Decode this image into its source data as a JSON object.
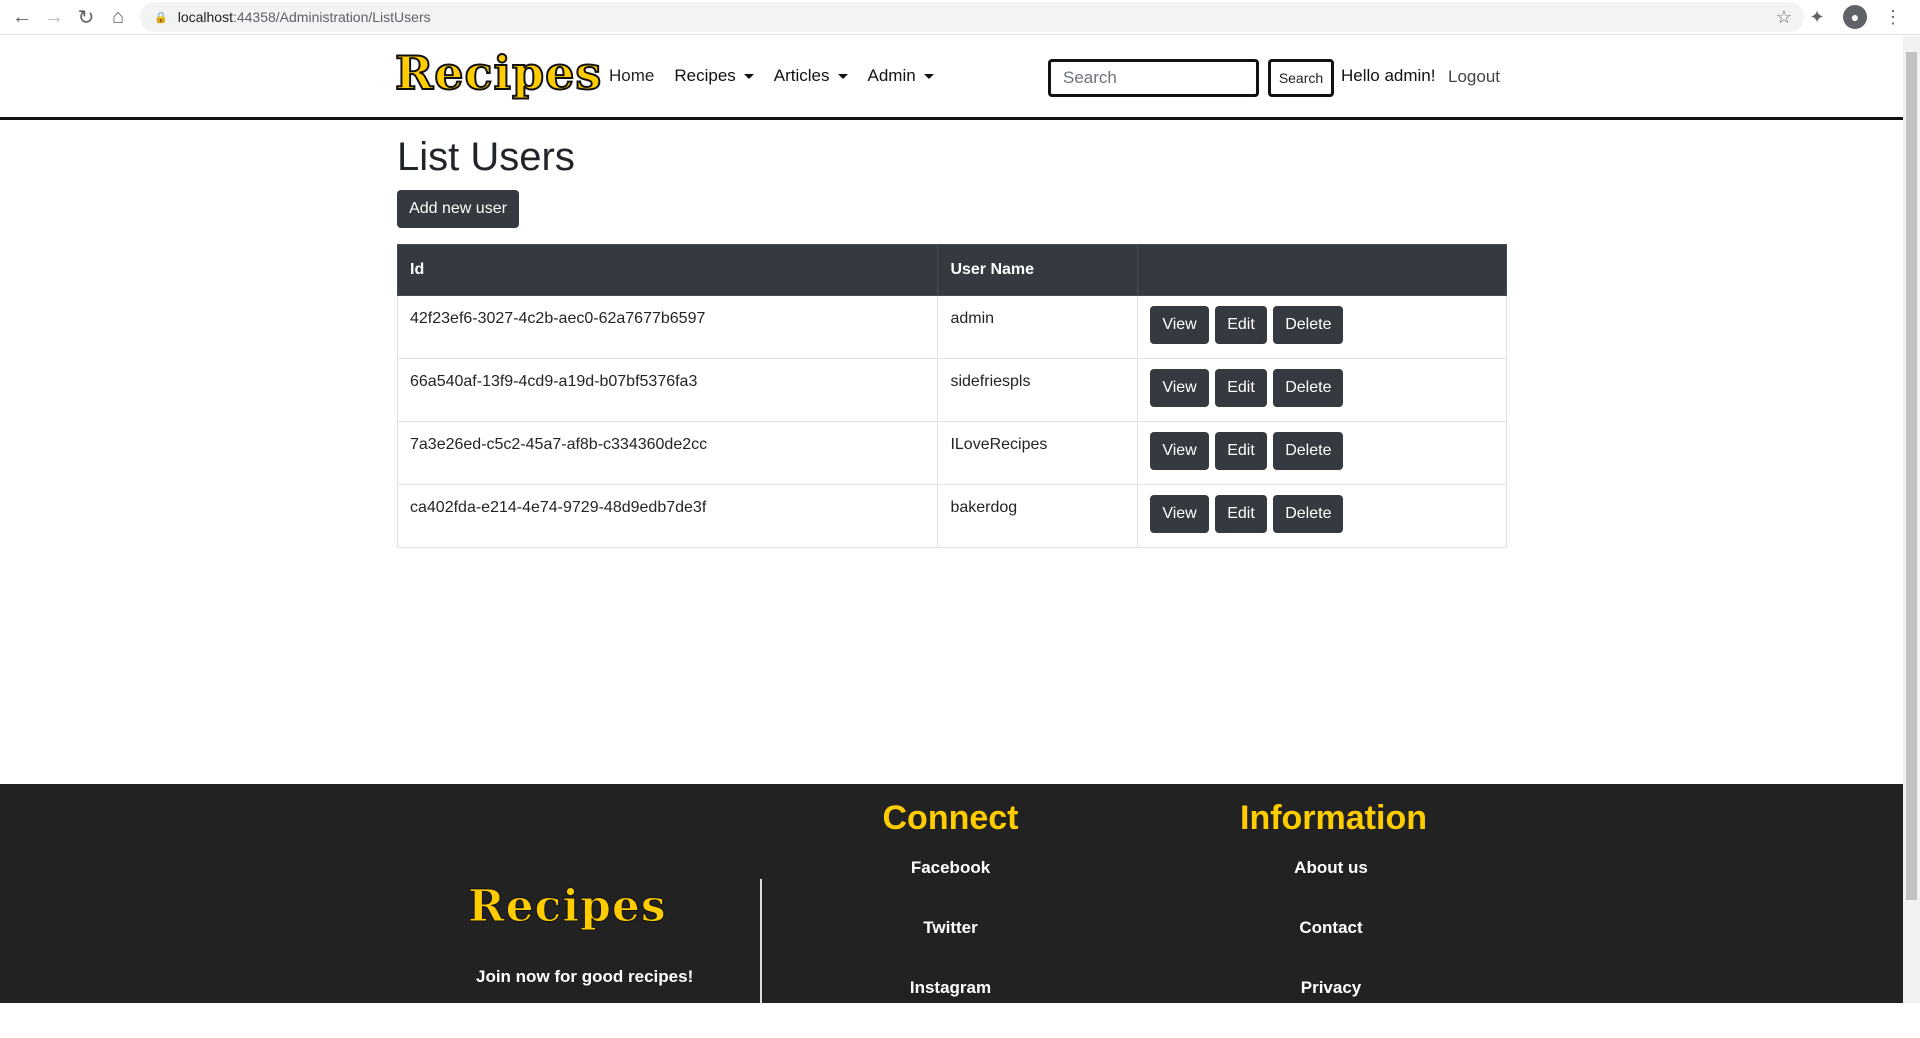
{
  "browser": {
    "url_host": "localhost",
    "url_rest": ":44358/Administration/ListUsers"
  },
  "header": {
    "logo": "Recipes",
    "nav": [
      {
        "label": "Home",
        "dropdown": false
      },
      {
        "label": "Recipes",
        "dropdown": true
      },
      {
        "label": "Articles",
        "dropdown": true
      },
      {
        "label": "Admin",
        "dropdown": true
      }
    ],
    "search_placeholder": "Search",
    "search_button": "Search",
    "greeting": "Hello admin!",
    "logout": "Logout"
  },
  "main": {
    "title": "List Users",
    "add_button": "Add new user",
    "table": {
      "headers": [
        "Id",
        "User Name",
        ""
      ],
      "rows": [
        {
          "id": "42f23ef6-3027-4c2b-aec0-62a7677b6597",
          "username": "admin"
        },
        {
          "id": "66a540af-13f9-4cd9-a19d-b07bf5376fa3",
          "username": "sidefriespls"
        },
        {
          "id": "7a3e26ed-c5c2-45a7-af8b-c334360de2cc",
          "username": "ILoveRecipes"
        },
        {
          "id": "ca402fda-e214-4e74-9729-48d9edb7de3f",
          "username": "bakerdog"
        }
      ],
      "actions": [
        "View",
        "Edit",
        "Delete"
      ]
    }
  },
  "footer": {
    "logo": "Recipes",
    "tagline": "Join now for good recipes!",
    "connect": {
      "title": "Connect",
      "links": [
        "Facebook",
        "Twitter",
        "Instagram"
      ]
    },
    "information": {
      "title": "Information",
      "links": [
        "About us",
        "Contact",
        "Privacy"
      ]
    }
  },
  "colors": {
    "brand_yellow": "#ffcc00",
    "dark": "#343a40",
    "footer_bg": "#222222"
  }
}
